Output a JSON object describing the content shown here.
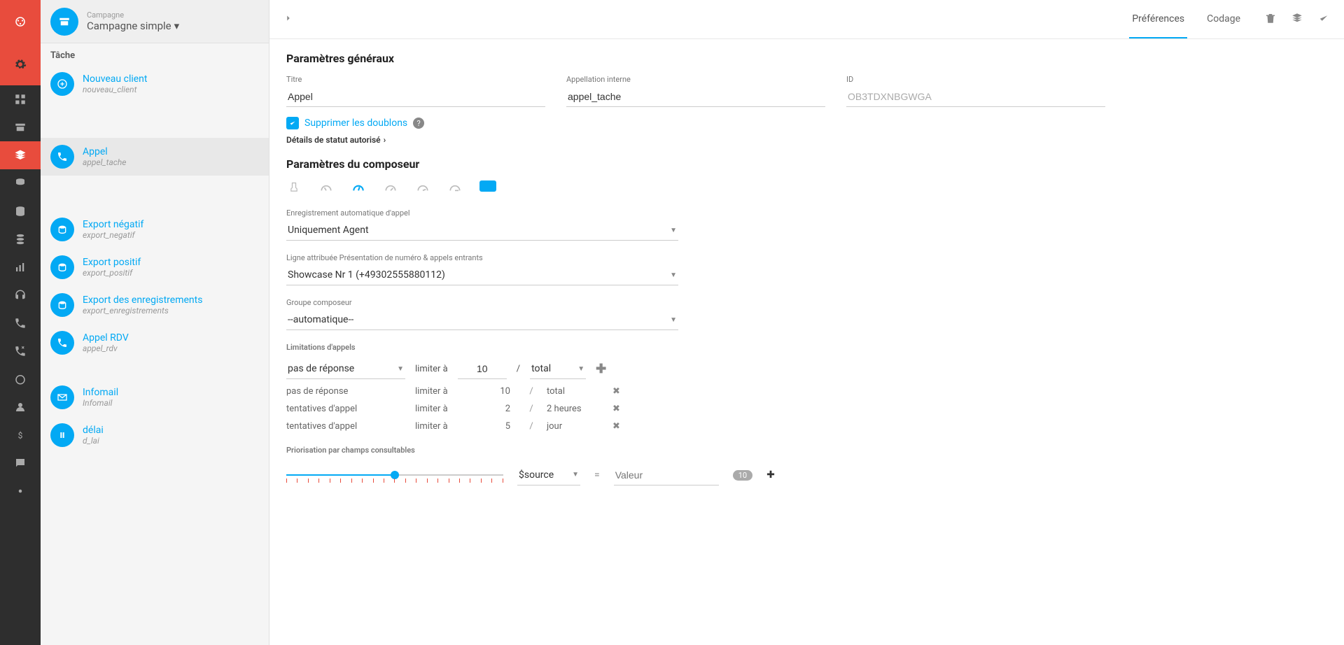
{
  "nav": {
    "items": [
      {
        "name": "nav-dashboard"
      },
      {
        "name": "nav-archive"
      },
      {
        "name": "nav-layers",
        "active": true
      },
      {
        "name": "nav-db1"
      },
      {
        "name": "nav-db2"
      },
      {
        "name": "nav-db3"
      },
      {
        "name": "nav-stats"
      },
      {
        "name": "nav-headset"
      },
      {
        "name": "nav-phone"
      },
      {
        "name": "nav-dialer"
      },
      {
        "name": "nav-timer"
      },
      {
        "name": "nav-user"
      },
      {
        "name": "nav-dollar"
      },
      {
        "name": "nav-chat"
      },
      {
        "name": "nav-settings"
      }
    ]
  },
  "sidebar": {
    "header": {
      "label": "Campagne",
      "value": "Campagne simple"
    },
    "section": "Tâche",
    "tasks": [
      {
        "title": "Nouveau client",
        "sub": "nouveau_client",
        "icon": "plus"
      },
      {
        "title": "Appel",
        "sub": "appel_tache",
        "icon": "phone",
        "active": true
      },
      {
        "title": "Export négatif",
        "sub": "export_negatif",
        "icon": "db"
      },
      {
        "title": "Export positif",
        "sub": "export_positif",
        "icon": "db"
      },
      {
        "title": "Export des enregistrements",
        "sub": "export_enregistrements",
        "icon": "db"
      },
      {
        "title": "Appel RDV",
        "sub": "appel_rdv",
        "icon": "phone"
      },
      {
        "title": "Infomail",
        "sub": "Infomail",
        "icon": "mail"
      },
      {
        "title": "délai",
        "sub": "d_lai",
        "icon": "pause"
      }
    ]
  },
  "topbar": {
    "tabs": [
      "Préférences",
      "Codage"
    ],
    "active_tab": 0
  },
  "general": {
    "heading": "Paramètres généraux",
    "title_label": "Titre",
    "title_value": "Appel",
    "internal_label": "Appellation interne",
    "internal_value": "appel_tache",
    "id_label": "ID",
    "id_value": "OB3TDXNBGWGA",
    "dedupe_label": "Supprimer les doublons",
    "details_link": "Détails de statut autorisé"
  },
  "dialer": {
    "heading": "Paramètres du composeur",
    "auto_rec_label": "Enregistrement automatique d'appel",
    "auto_rec_value": "Uniquement Agent",
    "line_label": "Ligne attribuée Présentation de numéro & appels entrants",
    "line_value": "Showcase Nr 1 (+49302555880112)",
    "group_label": "Groupe composeur",
    "group_value": "--automatique--",
    "limits_label": "Limitations d'appels",
    "limit_input": {
      "reason": "pas de réponse",
      "limiter": "limiter à",
      "value": "10",
      "sep": "/",
      "period": "total"
    },
    "limits": [
      {
        "reason": "pas de réponse",
        "limiter": "limiter à",
        "value": "10",
        "period": "total"
      },
      {
        "reason": "tentatives d'appel",
        "limiter": "limiter à",
        "value": "2",
        "period": "2 heures"
      },
      {
        "reason": "tentatives d'appel",
        "limiter": "limiter à",
        "value": "5",
        "period": "jour"
      }
    ],
    "priority_label": "Priorisation par champs consultables",
    "priority_field": "$source",
    "priority_eq": "=",
    "priority_value_placeholder": "Valeur",
    "priority_count": "10"
  }
}
